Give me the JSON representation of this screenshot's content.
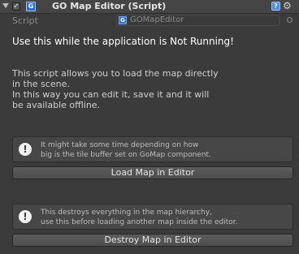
{
  "header": {
    "title": "GO Map Editor (Script)",
    "enabled_check": "✓",
    "script_icon_text": "G",
    "help_icon_text": "?",
    "gear_icon_glyph": "⚙"
  },
  "script_field": {
    "label": "Script",
    "value": "GOMapEditor",
    "icon_text": "G"
  },
  "notice": "Use this while the application is Not Running!",
  "description": [
    "This script allows you to load the map directly",
    "in the scene.",
    "In this way you can edit it, save it and it will",
    "be available offline."
  ],
  "load_section": {
    "help_lines": [
      "It might take some time depending on how",
      "big is the tile buffer set on GoMap component."
    ],
    "button_label": "Load Map in Editor"
  },
  "destroy_section": {
    "help_lines": [
      "This destroys everything in the map hierarchy,",
      "use this before loading another map inside the editor."
    ],
    "button_label": "Destroy Map in Editor"
  },
  "warning_icon_glyph": "!",
  "colors": {
    "background": "#3b3b3b",
    "header": "#454545",
    "text": "#d2d2d2",
    "notice": "#ffffff",
    "script_icon": "#2d6fd1"
  }
}
